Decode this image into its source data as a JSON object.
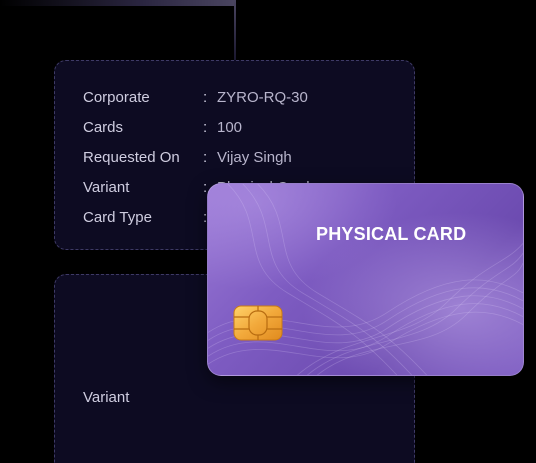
{
  "details": {
    "rows": [
      {
        "label": "Corporate",
        "value": "ZYRO-RQ-30"
      },
      {
        "label": "Cards",
        "value": "100"
      },
      {
        "label": "Requested On",
        "value": "Vijay Singh"
      },
      {
        "label": "Variant",
        "value": "Physical Card"
      },
      {
        "label": "Card Type",
        "value": ""
      }
    ],
    "colon": ":"
  },
  "lower_panel": {
    "variant_label": "Variant"
  },
  "card": {
    "title": "PHYSICAL CARD",
    "chip_icon": "sim-chip-icon",
    "colors": {
      "base": "#7e5cc2",
      "light": "#9b7ad6",
      "chip": "#f2a93b"
    }
  }
}
